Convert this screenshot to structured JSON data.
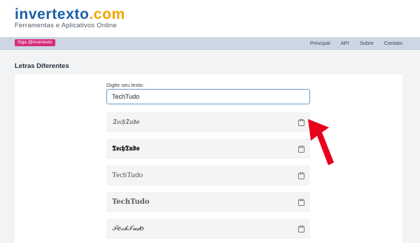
{
  "header": {
    "logo_part1": "invertexto",
    "logo_part2": ".com",
    "tagline": "Ferramentas e Aplicativos Online"
  },
  "navbar": {
    "badge": "Siga @invertexto",
    "links": [
      "Principal",
      "API",
      "Sobre",
      "Contato"
    ]
  },
  "page": {
    "title": "Letras Diferentes",
    "input_label": "Digite seu texto:",
    "input_value": "TechTudo"
  },
  "results": [
    {
      "text": "𝔗𝔢𝔠𝔥𝔗𝔲𝔡𝔬",
      "icon": "clipboard-icon"
    },
    {
      "text": "𝕿𝖊𝖈𝖍𝕿𝖚𝖉𝖔",
      "icon": "clipboard-icon"
    },
    {
      "text": "TechTudo",
      "icon": "clipboard-icon"
    },
    {
      "text": "TechTudo",
      "icon": "clipboard-icon"
    },
    {
      "text": "𝒯𝑒𝒸𝒽𝒯𝓊𝒹𝑜",
      "icon": "clipboard-icon"
    }
  ],
  "annotation": {
    "icon": "red-arrow-icon",
    "color": "#e8001c"
  }
}
